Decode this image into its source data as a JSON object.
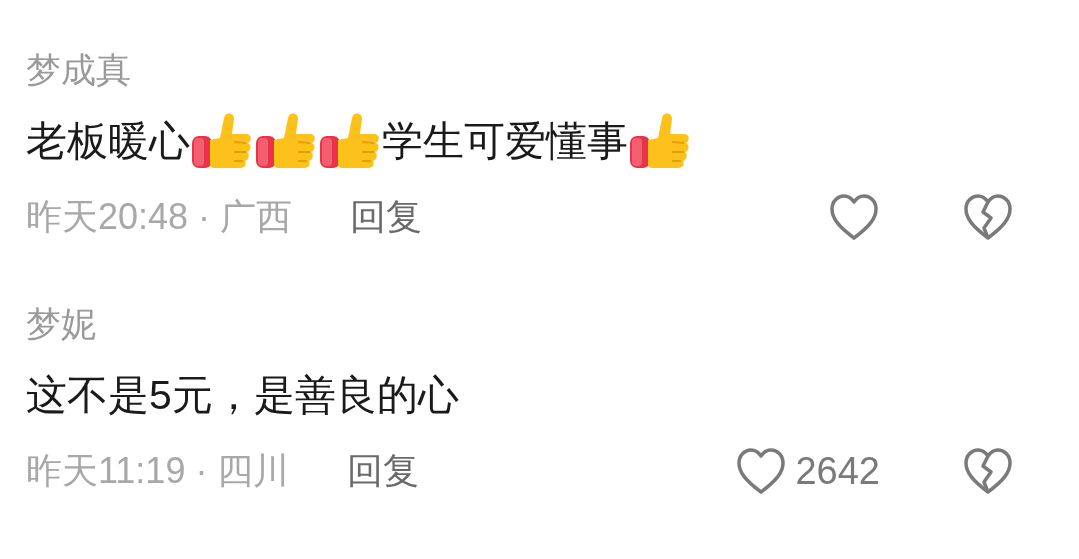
{
  "comments": [
    {
      "author": "梦成真",
      "body": [
        {
          "kind": "text",
          "text": "老板暖心"
        },
        {
          "kind": "thumbs_up"
        },
        {
          "kind": "thumbs_up"
        },
        {
          "kind": "thumbs_up"
        },
        {
          "kind": "text",
          "text": "学生可爱懂事"
        },
        {
          "kind": "thumbs_up"
        }
      ],
      "meta": "昨天20:48 · 广西",
      "reply": "回复"
    },
    {
      "author": "梦妮",
      "body": [
        {
          "kind": "text",
          "text": "这不是5元，是善良的心"
        }
      ],
      "meta": "昨天11:19 · 四川",
      "reply": "回复",
      "likes": "2642"
    }
  ]
}
